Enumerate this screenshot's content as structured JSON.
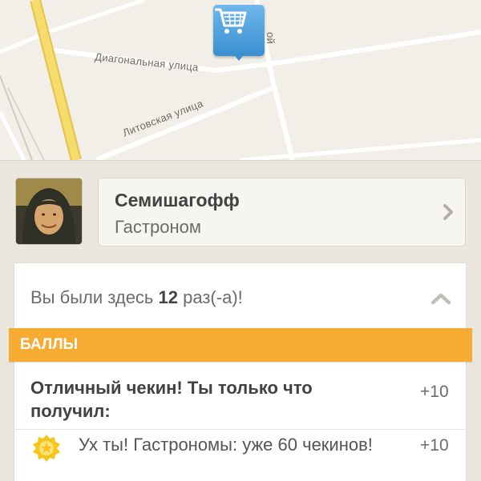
{
  "map": {
    "streets": [
      "Диагональная улица",
      "Литовская улица"
    ],
    "street_partial": "ой",
    "pin_icon": "shopping-cart-icon",
    "colors": {
      "pin": "#3a8fd0",
      "major_road": "#f3d35c"
    }
  },
  "venue": {
    "name": "Семишагофф",
    "category": "Гастроном",
    "chevron_icon": "chevron-right-icon"
  },
  "visits": {
    "prefix": "Вы были здесь",
    "count": "12",
    "suffix": "раз(-а)!",
    "toggle_icon": "chevron-up-icon"
  },
  "points": {
    "header": "БАЛЛЫ",
    "accent": "#f6ab33",
    "rows": [
      {
        "text": "Отличный чекин! Ты только что получил:",
        "value": "+10"
      },
      {
        "text": "Ух ты!  Гастрономы: уже 60 чекинов!",
        "value": "+10",
        "icon": "star-badge-icon"
      }
    ]
  }
}
